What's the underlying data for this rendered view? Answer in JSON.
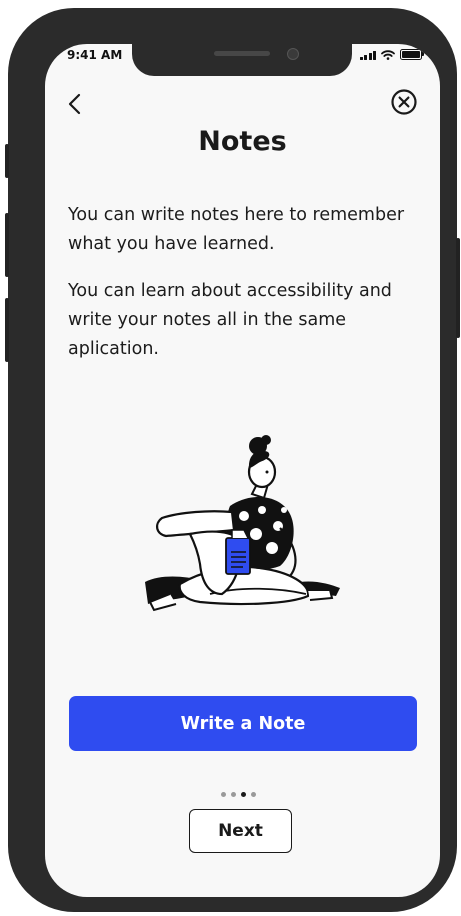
{
  "status_bar": {
    "time": "9:41 AM"
  },
  "header": {
    "title": "Notes"
  },
  "content": {
    "paragraphs": [
      "You can write notes here to remember what you have learned.",
      "You can learn about accessibility and write your notes all in the same aplication."
    ]
  },
  "actions": {
    "primary_label": "Write a Note",
    "next_label": "Next"
  },
  "pagination": {
    "total": 4,
    "current": 3
  },
  "icons": {
    "back": "chevron-left-icon",
    "close": "circle-x-icon",
    "illustration": "woman-reading-illustration"
  },
  "colors": {
    "accent": "#2f4cf0",
    "background": "#f8f8f8",
    "text": "#1a1a1a"
  }
}
